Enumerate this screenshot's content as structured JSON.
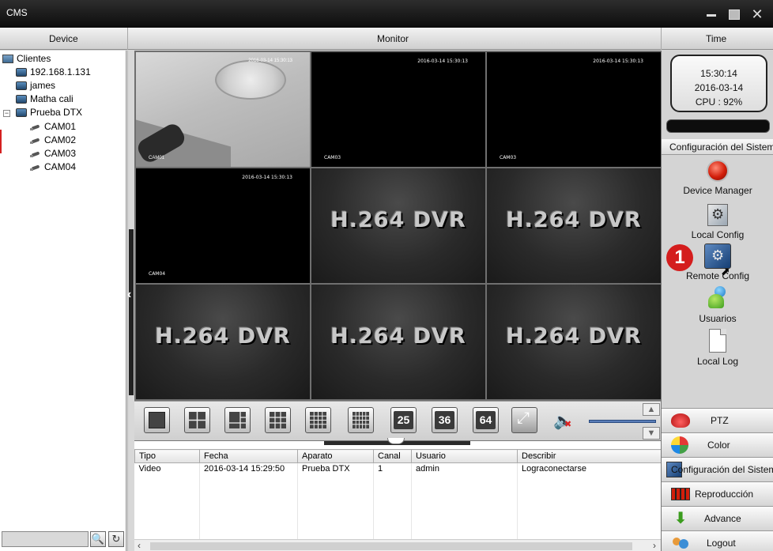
{
  "window": {
    "title": "CMS"
  },
  "header": {
    "device": "Device",
    "monitor": "Monitor",
    "time": "Time"
  },
  "device_tree": {
    "root": "Clientes",
    "items": [
      {
        "label": "192.168.1.131"
      },
      {
        "label": "james"
      },
      {
        "label": "Matha cali"
      },
      {
        "label": "Prueba DTX"
      }
    ],
    "cameras": [
      "CAM01",
      "CAM02",
      "CAM03",
      "CAM04"
    ],
    "expander": "−"
  },
  "video": {
    "timestamp": "2016-03-14 15:30:13",
    "labels": {
      "cam01": "CAM01",
      "cam03": "CAM03",
      "cam04": "CAM04"
    },
    "dvr_text": "H.264 DVR"
  },
  "toolbar": {
    "layout_25": "25",
    "layout_36": "36",
    "layout_64": "64"
  },
  "log": {
    "columns": [
      "Tipo",
      "Fecha",
      "Aparato",
      "Canal",
      "Usuario",
      "Describir"
    ],
    "rows": [
      {
        "tipo": "Video",
        "fecha": "2016-03-14 15:29:50",
        "aparato": "Prueba DTX",
        "canal": "1",
        "usuario": "admin",
        "describir": "Lograconectarse"
      }
    ]
  },
  "clock": {
    "time": "15:30:14",
    "date": "2016-03-14",
    "cpu": "CPU : 92%"
  },
  "system": {
    "header": "Configuración del Sistem",
    "items": [
      {
        "label": "Device Manager",
        "icon": "device-manager-icon"
      },
      {
        "label": "Local Config",
        "icon": "local-config-icon"
      },
      {
        "label": "Remote Config",
        "icon": "remote-config-icon"
      },
      {
        "label": "Usuarios",
        "icon": "users-icon"
      },
      {
        "label": "Local Log",
        "icon": "local-log-icon"
      }
    ],
    "step_badge": "1"
  },
  "nav": [
    {
      "label": "PTZ",
      "icon": "ptz-icon"
    },
    {
      "label": "Color",
      "icon": "color-icon"
    },
    {
      "label": "Configuración del Sistema",
      "icon": "system-config-icon"
    },
    {
      "label": "Reproducción",
      "icon": "playback-icon"
    },
    {
      "label": "Advance",
      "icon": "advance-icon"
    },
    {
      "label": "Logout",
      "icon": "logout-icon"
    }
  ]
}
